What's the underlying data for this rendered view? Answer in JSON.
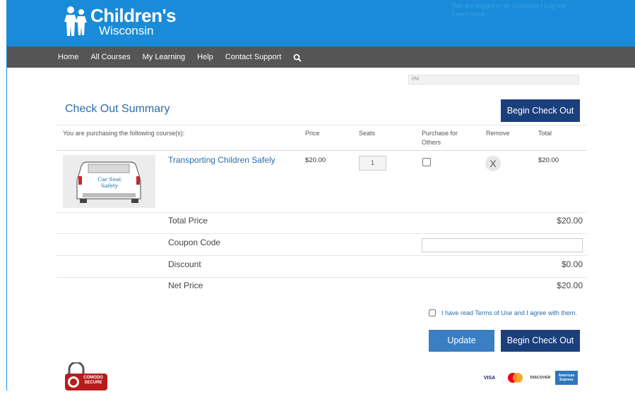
{
  "header": {
    "logo_line1": "Children's",
    "logo_line2": "Wisconsin",
    "top_right_line1": "You are logged in as Customer | Log out",
    "top_right_line2": "Learn more"
  },
  "nav": {
    "items": [
      "Home",
      "All Courses",
      "My Learning",
      "Help",
      "Contact Support"
    ]
  },
  "progress": {
    "label": "0%",
    "value": 0
  },
  "page": {
    "title": "Check Out Summary",
    "begin_checkout_label": "Begin Check Out"
  },
  "table": {
    "headers": {
      "courses": "You are purchasing the following course(s):",
      "price": "Price",
      "seats": "Seats",
      "purchase_for_others": "Purchase for Others",
      "remove": "Remove",
      "total": "Total"
    },
    "rows": [
      {
        "thumb_text": "Car Seat Safety",
        "course_name": "Transporting Children Safely",
        "price": "$20.00",
        "seats": "1",
        "purchase_for_others": false,
        "remove_label": "X",
        "total": "$20.00"
      }
    ]
  },
  "summary": {
    "total_price_label": "Total Price",
    "total_price": "$20.00",
    "coupon_label": "Coupon Code",
    "coupon_value": "",
    "discount_label": "Discount",
    "discount": "$0.00",
    "net_price_label": "Net Price",
    "net_price": "$20.00"
  },
  "terms": {
    "label": "I have read Terms of Use and I agree with them.",
    "checked": false
  },
  "actions": {
    "update_label": "Update",
    "begin_checkout_label": "Begin Check Out"
  },
  "footer": {
    "secure_badge": "COMODO SECURE",
    "cards": [
      "VISA",
      "Mastercard",
      "DISCOVER",
      "American Express"
    ]
  },
  "colors": {
    "header_blue": "#1a8bd8",
    "nav_gray": "#555555",
    "dark_button": "#1a3f7c",
    "update_button": "#3a7ec3",
    "link_blue": "#2b6ea8"
  }
}
